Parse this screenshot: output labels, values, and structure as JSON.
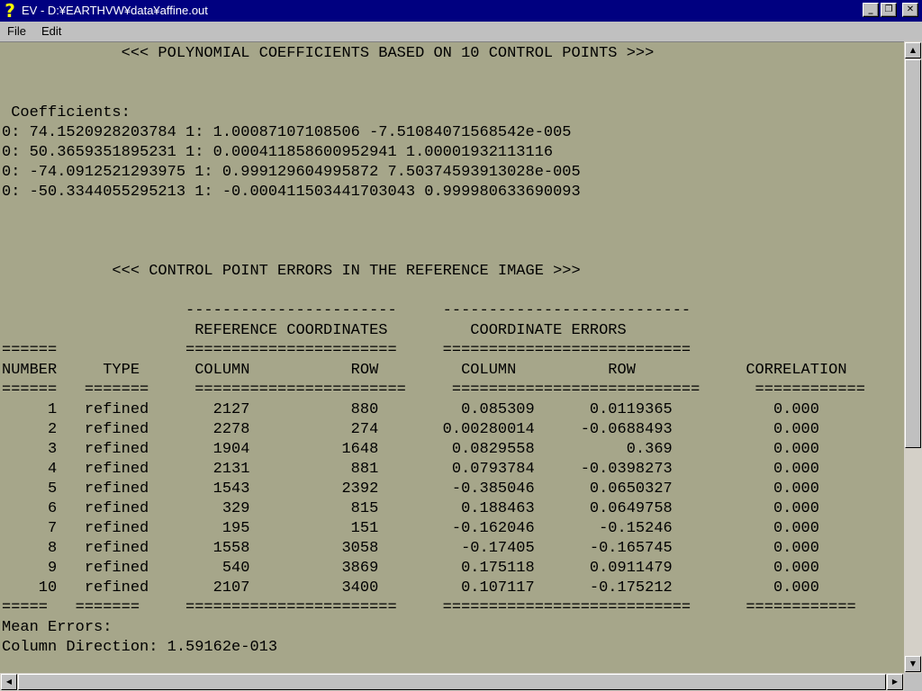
{
  "window": {
    "title": "EV - D:¥EARTHVW¥data¥affine.out",
    "app_icon": "question-mark-icon",
    "controls": {
      "minimize": "minimize-icon",
      "maximize": "restore-icon",
      "close": "close-icon"
    }
  },
  "menu": {
    "file": "File",
    "edit": "Edit"
  },
  "document": {
    "lines": [
      "             <<< POLYNOMIAL COEFFICIENTS BASED ON 10 CONTROL POINTS >>>",
      "",
      "",
      " Coefficients:",
      "0: 74.1520928203784 1: 1.00087107108506 -7.51084071568542e-005",
      "0: 50.3659351895231 1: 0.000411858600952941 1.00001932113116",
      "0: -74.0912521293975 1: 0.999129604995872 7.50374593913028e-005",
      "0: -50.3344055295213 1: -0.000411503441703043 0.999980633690093",
      "",
      "",
      "",
      "            <<< CONTROL POINT ERRORS IN THE REFERENCE IMAGE >>>",
      "",
      "                    -----------------------     ---------------------------",
      "                     REFERENCE COORDINATES         COORDINATE ERRORS",
      "======              =======================     ===========================",
      "NUMBER     TYPE      COLUMN           ROW         COLUMN          ROW            CORRELATION",
      "======   =======     =======================     ===========================      ============",
      "     1   refined       2127           880         0.085309      0.0119365           0.000",
      "     2   refined       2278           274       0.00280014     -0.0688493           0.000",
      "     3   refined       1904          1648        0.0829558          0.369           0.000",
      "     4   refined       2131           881        0.0793784     -0.0398273           0.000",
      "     5   refined       1543          2392        -0.385046      0.0650327           0.000",
      "     6   refined        329           815         0.188463      0.0649758           0.000",
      "     7   refined        195           151        -0.162046       -0.15246           0.000",
      "     8   refined       1558          3058         -0.17405      -0.165745           0.000",
      "     9   refined        540          3869         0.175118      0.0911479           0.000",
      "    10   refined       2107          3400         0.107117      -0.175212           0.000",
      "=====   =======     =======================     ===========================      ============",
      "Mean Errors:",
      "Column Direction: 1.59162e-013"
    ]
  },
  "scrollbars": {
    "up": "scroll-up-arrow-icon",
    "down": "scroll-down-arrow-icon",
    "left": "scroll-left-arrow-icon",
    "right": "scroll-right-arrow-icon"
  }
}
